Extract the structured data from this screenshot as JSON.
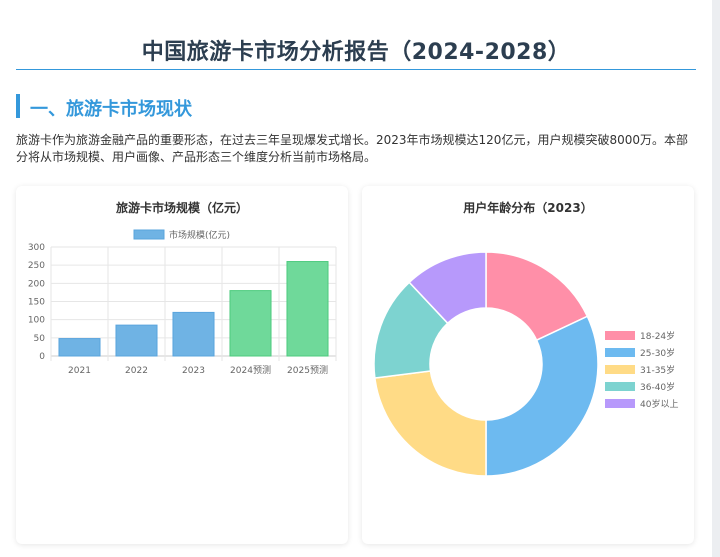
{
  "report": {
    "title": "中国旅游卡市场分析报告（2024-2028）",
    "section1_title": "一、旅游卡市场现状",
    "intro": "旅游卡作为旅游金融产品的重要形态，在过去三年呈现爆发式增长。2023年市场规模达120亿元，用户规模突破8000万。本部分将从市场规模、用户画像、产品形态三个维度分析当前市场格局。"
  },
  "chart_data": [
    {
      "type": "bar",
      "title": "旅游卡市场规模（亿元）",
      "categories": [
        "2021",
        "2022",
        "2023",
        "2024预测",
        "2025预测"
      ],
      "series": [
        {
          "name": "市场规模(亿元)",
          "values": [
            48,
            85,
            120,
            180,
            260
          ]
        }
      ],
      "ylim": [
        0,
        300
      ],
      "yticks": [
        0,
        50,
        100,
        150,
        200,
        250,
        300
      ],
      "legend": "top",
      "grid": true,
      "colors": {
        "actual_fill": "#6fb3e4",
        "actual_stroke": "#5aa4dd",
        "forecast_fill": "#6fd99a",
        "forecast_stroke": "#4ccb7e",
        "legend_swatch": "#6fb3e4"
      }
    },
    {
      "type": "pie",
      "title": "用户年龄分布（2023）",
      "donut": true,
      "legend": "right",
      "labels": [
        "18-24岁",
        "25-30岁",
        "31-35岁",
        "36-40岁",
        "40岁以上"
      ],
      "values": [
        18,
        32,
        23,
        15,
        12
      ],
      "colors": [
        "#ff8fa8",
        "#6dbaf0",
        "#ffdb86",
        "#7dd3d0",
        "#b799fb"
      ]
    }
  ]
}
